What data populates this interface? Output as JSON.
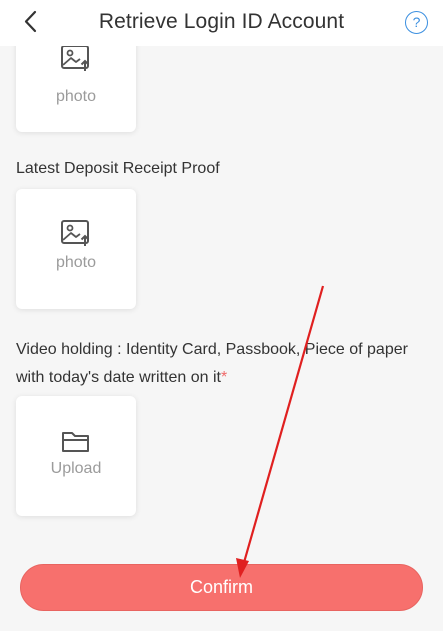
{
  "header": {
    "back_icon": "chevron-left-icon",
    "title": "Retrieve Login ID Account",
    "help_icon": "question-circle-icon",
    "help_glyph": "?"
  },
  "uploads": [
    {
      "icon": "image-upload-icon",
      "label": "photo"
    },
    {
      "icon": "image-upload-icon",
      "label": "photo"
    },
    {
      "icon": "folder-icon",
      "label": "Upload"
    }
  ],
  "sections": {
    "deposit_label": "Latest Deposit Receipt Proof",
    "video_label": "Video holding : Identity Card, Passbook, Piece of paper with today's date written on it",
    "required_mark": "*"
  },
  "confirm": {
    "label": "Confirm"
  },
  "colors": {
    "accent": "#f7706d",
    "help": "#3b8fe0",
    "required": "#f06a6a",
    "annotation": "#e02020"
  }
}
